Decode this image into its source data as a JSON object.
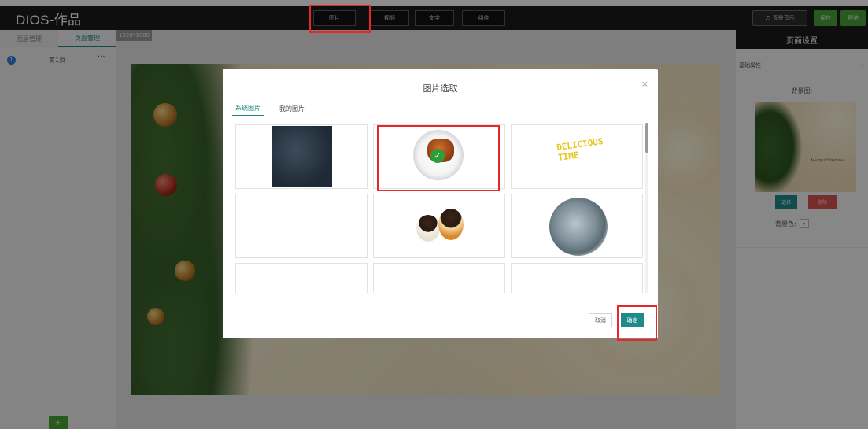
{
  "app": {
    "title": "DIOS-作品"
  },
  "toolbar": {
    "image": "图片",
    "video": "视频",
    "text": "文字",
    "component": "组件"
  },
  "header": {
    "music": "背景音乐",
    "save": "保存",
    "preview": "预览"
  },
  "left_panel": {
    "tabs": [
      "图层管理",
      "页面管理"
    ],
    "active_tab": 1,
    "page_item": {
      "number": "1",
      "label": "第1页",
      "more": "···"
    },
    "add_page": "+"
  },
  "canvas": {
    "size_label": "1920*1080"
  },
  "modal": {
    "title": "图片选取",
    "close": "×",
    "tabs": [
      "系统图片",
      "我的图片"
    ],
    "active_tab": 0,
    "thumb_text": "DELICIOUS\nTIME",
    "cancel": "取消",
    "confirm": "确定"
  },
  "right_panel": {
    "title": "页面设置",
    "section": "基础属性",
    "bg_image_label": "背景图:",
    "bg_thumb_text": "Merry Christmas",
    "select": "选择",
    "delete": "删除",
    "bg_color_label": "背景色:"
  },
  "colors": {
    "accent": "#1e8a8a",
    "highlight": "#e8272b",
    "green": "#4aa53a",
    "danger": "#d9534f"
  }
}
